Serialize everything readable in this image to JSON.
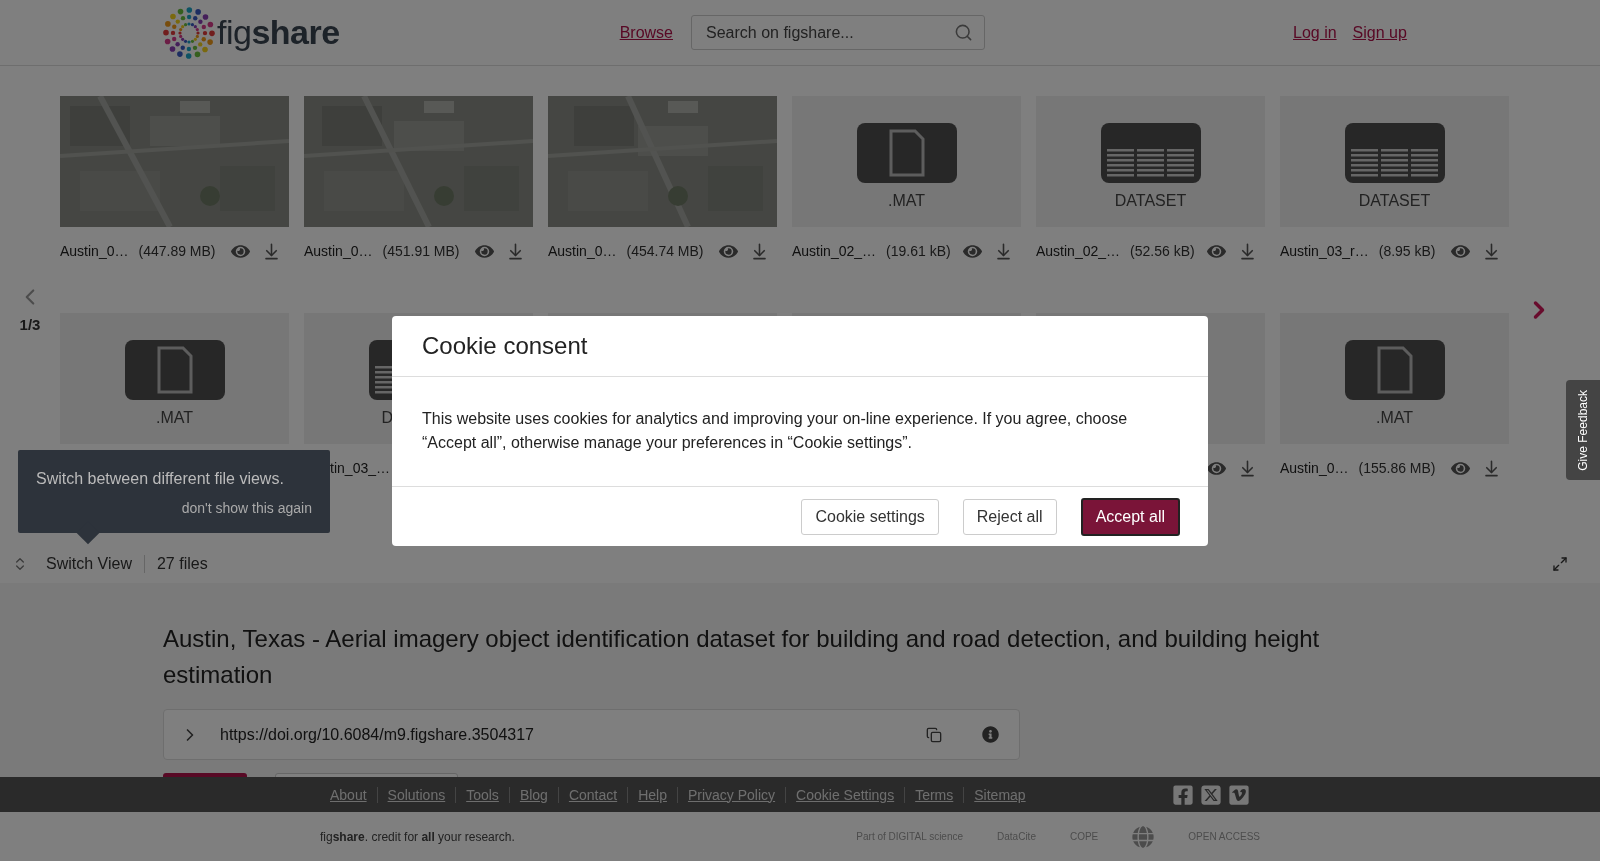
{
  "header": {
    "logo": "fig**share**",
    "nav_link": "Browse",
    "search": {
      "placeholder": "Search on figshare..."
    },
    "auth_links": [
      "Log in",
      "Sign up"
    ]
  },
  "carousel": {
    "page": "1/3",
    "rows": [
      [
        {
          "actions": true,
          "name": "Austin_0…",
          "size": "(447.89 MB)"
        },
        {
          "actions": true,
          "name": "Austin_0…",
          "size": "(451.91 MB)"
        },
        {
          "actions": true,
          "name": "Austin_0…",
          "size": "(454.74 MB)"
        },
        {
          "kind": "mat",
          "label": ".MAT",
          "actions": true,
          "name": "Austin_02_…",
          "size": "(19.61 kB)"
        },
        {
          "kind": "dataset",
          "label": "DATASET",
          "actions": true,
          "name": "Austin_02_…",
          "size": "(52.56 kB)"
        },
        {
          "kind": "dataset",
          "label": "DATASET",
          "actions": true,
          "name": "Austin_03_r…",
          "size": "(8.95 kB)"
        }
      ],
      [
        {
          "kind": "mat",
          "label": ".MAT"
        },
        {
          "kind": "dataset",
          "label": "D",
          "clipped": true,
          "name": "tin_03_…"
        },
        {
          "kind": "blank"
        },
        {
          "kind": "blank"
        },
        {
          "kind": "blank",
          "actions": true
        },
        {
          "kind": "mat",
          "label": ".MAT",
          "actions": true,
          "name": "Austin_0…",
          "size": "(155.86 MB)"
        }
      ]
    ]
  },
  "tooltip": {
    "text": "Switch between different file views.",
    "dismiss": "don't show this again"
  },
  "view_bar": {
    "switch": "Switch View",
    "count": "27 files"
  },
  "article": {
    "title": "Austin, Texas - Aerial imagery object identification dataset for building and road detection, and building height estimation",
    "doi": "https://doi.org/10.6084/m9.figshare.3504317"
  },
  "feedback": "Give Feedback",
  "footer": {
    "links": [
      "About",
      "Solutions",
      "Tools",
      "Blog",
      "Contact",
      "Help",
      "Privacy Policy",
      "Cookie Settings",
      "Terms",
      "Sitemap"
    ],
    "tagline": "fig**share**. credit for **all** your research.",
    "partners": [
      "Part of DIGITAL science",
      "DataCite",
      "COPE",
      "OPEN ACCESS"
    ]
  },
  "cookie_modal": {
    "title": "Cookie consent",
    "text": "This website uses cookies for analytics and improving your on-line experience. If you agree, choose “Accept all”, otherwise manage your preferences in “Cookie settings”.",
    "buttons": [
      {
        "label": "Cookie settings",
        "primary": false
      },
      {
        "label": "Reject all",
        "primary": false
      },
      {
        "label": "Accept all",
        "primary": true
      }
    ]
  }
}
